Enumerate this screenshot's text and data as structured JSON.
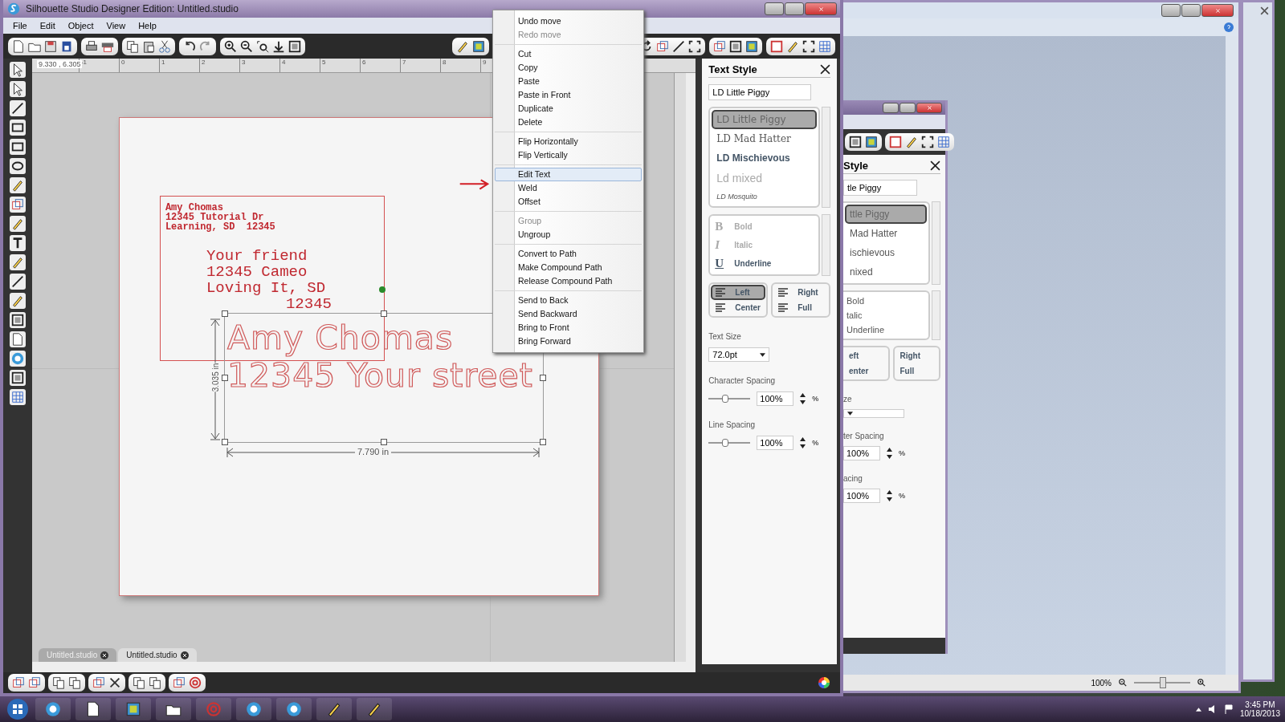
{
  "window": {
    "title": "Silhouette Studio Designer Edition: Untitled.studio"
  },
  "menu_bar": [
    "File",
    "Edit",
    "Object",
    "View",
    "Help"
  ],
  "ruler": {
    "coordinates": "9.330 , 6.305",
    "ticks": [
      "-1",
      "0",
      "1",
      "2",
      "3",
      "4",
      "5",
      "6",
      "7",
      "8",
      "9"
    ]
  },
  "canvas": {
    "return_address": [
      "Amy Chomas",
      "12345 Tutorial Dr",
      "Learning, SD  12345"
    ],
    "recipient": [
      "Your friend",
      "12345 Cameo",
      "Loving It, SD",
      "12345"
    ],
    "outlined_text": [
      "Amy Chomas",
      "12345 Your street"
    ],
    "height_label": "3.035 in",
    "width_label": "7.790 in"
  },
  "context_menu": [
    [
      {
        "label": "Undo move",
        "disabled": false,
        "selected": false
      },
      {
        "label": "Redo move",
        "disabled": true,
        "selected": false
      }
    ],
    [
      {
        "label": "Cut",
        "disabled": false,
        "selected": false
      },
      {
        "label": "Copy",
        "disabled": false,
        "selected": false
      },
      {
        "label": "Paste",
        "disabled": false,
        "selected": false
      },
      {
        "label": "Paste in Front",
        "disabled": false,
        "selected": false
      },
      {
        "label": "Duplicate",
        "disabled": false,
        "selected": false
      },
      {
        "label": "Delete",
        "disabled": false,
        "selected": false
      }
    ],
    [
      {
        "label": "Flip Horizontally",
        "disabled": false,
        "selected": false
      },
      {
        "label": "Flip Vertically",
        "disabled": false,
        "selected": false
      }
    ],
    [
      {
        "label": "Edit Text",
        "disabled": false,
        "selected": true
      },
      {
        "label": "Weld",
        "disabled": false,
        "selected": false
      },
      {
        "label": "Offset",
        "disabled": false,
        "selected": false
      }
    ],
    [
      {
        "label": "Group",
        "disabled": true,
        "selected": false
      },
      {
        "label": "Ungroup",
        "disabled": false,
        "selected": false
      }
    ],
    [
      {
        "label": "Convert to Path",
        "disabled": false,
        "selected": false
      },
      {
        "label": "Make Compound Path",
        "disabled": false,
        "selected": false
      },
      {
        "label": "Release Compound Path",
        "disabled": false,
        "selected": false
      }
    ],
    [
      {
        "label": "Send to Back",
        "disabled": false,
        "selected": false
      },
      {
        "label": "Send Backward",
        "disabled": false,
        "selected": false
      },
      {
        "label": "Bring to Front",
        "disabled": false,
        "selected": false
      },
      {
        "label": "Bring Forward",
        "disabled": false,
        "selected": false
      }
    ]
  ],
  "document_tabs": [
    {
      "label": "Untitled.studio",
      "selected": false
    },
    {
      "label": "Untitled.studio",
      "selected": true
    }
  ],
  "text_style": {
    "title": "Text Style",
    "font_field": "LD Little Piggy",
    "fonts": [
      {
        "label": "LD Little Piggy",
        "kind": "rounded",
        "selected": true
      },
      {
        "label": "LD Mad Hatter",
        "kind": "gothic",
        "selected": false
      },
      {
        "label": "LD Mischievous",
        "kind": "bold",
        "selected": false
      },
      {
        "label": "Ld mixed",
        "kind": "thin",
        "selected": false
      },
      {
        "label": "LD Mosquito",
        "kind": "script",
        "selected": false
      }
    ],
    "styles": [
      {
        "glyph": "B",
        "label": "Bold",
        "disabled": true
      },
      {
        "glyph": "I",
        "label": "Italic",
        "disabled": true
      },
      {
        "glyph": "U",
        "label": "Underline",
        "disabled": false
      }
    ],
    "align": [
      [
        {
          "label": "Left",
          "selected": true
        },
        {
          "label": "Center",
          "selected": false
        }
      ],
      [
        {
          "label": "Right",
          "selected": false
        },
        {
          "label": "Full",
          "selected": false
        }
      ]
    ],
    "size_label": "Text Size",
    "size": "72.0pt",
    "spacing": [
      {
        "label": "Character Spacing",
        "level": 0.4,
        "value": "100%",
        "unit": "%"
      },
      {
        "label": "Line Spacing",
        "level": 0.4,
        "value": "100%",
        "unit": "%"
      }
    ]
  },
  "back_window": {
    "title": "Style",
    "font_field": "tle Piggy",
    "fonts": [
      {
        "label": "ttle Piggy",
        "selected": true
      },
      {
        "label": "Mad Hatter",
        "selected": false
      },
      {
        "label": "ischievous",
        "selected": false
      },
      {
        "label": "nixed",
        "selected": false
      }
    ],
    "styles": [
      "Bold",
      "talic",
      "Underline"
    ],
    "align": [
      [
        "eft",
        "enter"
      ],
      [
        "Right",
        "Full"
      ]
    ],
    "size_label": "ze",
    "spacing": [
      {
        "label": "ter Spacing",
        "value": "100%",
        "unit": "%"
      },
      {
        "label": "acing",
        "value": "100%",
        "unit": "%"
      }
    ]
  },
  "document_window": {
    "zoom": "100%",
    "level": 0.5
  },
  "taskbar": {
    "time": "3:45 PM",
    "date": "10/18/2013"
  }
}
